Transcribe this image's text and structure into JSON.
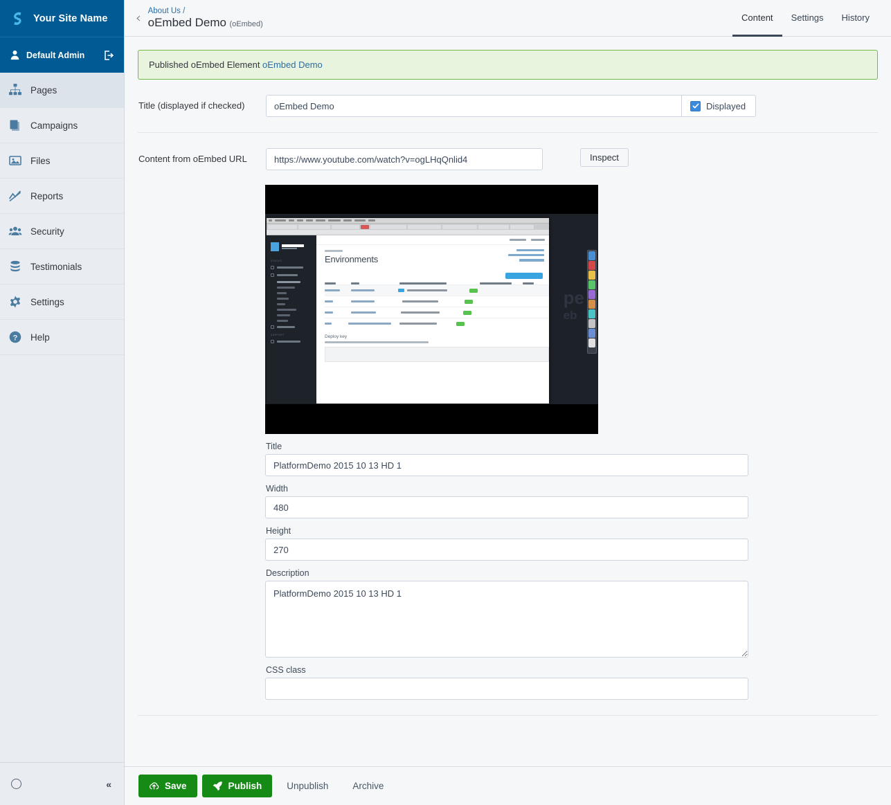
{
  "sidebar": {
    "brand": {
      "name": "Your Site Name",
      "logo_icon": "silverstripe-logo-icon"
    },
    "profile": {
      "name": "Default Admin",
      "user_icon": "user-icon",
      "logout_icon": "logout-icon"
    },
    "items": [
      {
        "label": "Pages",
        "icon": "sitemap-icon",
        "active": true
      },
      {
        "label": "Campaigns",
        "icon": "copies-icon",
        "active": false
      },
      {
        "label": "Files",
        "icon": "image-icon",
        "active": false
      },
      {
        "label": "Reports",
        "icon": "line-chart-icon",
        "active": false
      },
      {
        "label": "Security",
        "icon": "users-icon",
        "active": false
      },
      {
        "label": "Testimonials",
        "icon": "database-icon",
        "active": false
      },
      {
        "label": "Settings",
        "icon": "gear-icon",
        "active": false
      },
      {
        "label": "Help",
        "icon": "question-mark-icon",
        "active": false
      }
    ],
    "footer": {
      "spinner_icon": "loading-circle-icon",
      "collapse_icon": "chevron-double-left-icon",
      "collapse_label": "«"
    }
  },
  "header": {
    "back_icon": "chevron-left-icon",
    "back_label": "‹",
    "breadcrumb_parent": "About Us /",
    "title": "oEmbed Demo",
    "title_type": "(oEmbed)",
    "tabs": [
      {
        "label": "Content",
        "active": true
      },
      {
        "label": "Settings",
        "active": false
      },
      {
        "label": "History",
        "active": false
      }
    ]
  },
  "alert": {
    "text": "Published oEmbed Element ",
    "link_text": "oEmbed Demo",
    "bg_color": "#e8f4de",
    "border_color": "#73b947"
  },
  "form": {
    "title_field": {
      "label": "Title (displayed if checked)",
      "value": "oEmbed Demo",
      "placeholder": ""
    },
    "displayed_checkbox": {
      "label": "Displayed",
      "checked": true,
      "accent_color": "#3b8bdc"
    },
    "url_field": {
      "label": "Content from oEmbed URL",
      "value": "https://www.youtube.com/watch?v=ogLHqQnlid4",
      "placeholder": ""
    },
    "inspect_button": {
      "label": "Inspect"
    },
    "preview": {
      "alt": "PlatformDemo 2015 10 13 HD 1 video preview",
      "inner_heading": "Environments",
      "inner_section": "Deploy key",
      "inner_section_sub": "Permit us access to your private repositories by adding this deployment key",
      "brand": "SilverStripe"
    },
    "embed_fields": [
      {
        "name": "title",
        "label": "Title",
        "value": "PlatformDemo 2015 10 13 HD 1",
        "type": "text"
      },
      {
        "name": "width",
        "label": "Width",
        "value": "480",
        "type": "text"
      },
      {
        "name": "height",
        "label": "Height",
        "value": "270",
        "type": "text"
      },
      {
        "name": "description",
        "label": "Description",
        "value": "PlatformDemo 2015 10 13 HD 1",
        "type": "textarea"
      },
      {
        "name": "css-class",
        "label": "CSS class",
        "value": "",
        "type": "text"
      }
    ]
  },
  "actions": {
    "save": {
      "label": "Save",
      "icon": "cloud-upload-icon",
      "color": "#158a15"
    },
    "publish": {
      "label": "Publish",
      "icon": "rocket-icon",
      "color": "#158a15"
    },
    "unpublish": {
      "label": "Unpublish"
    },
    "archive": {
      "label": "Archive"
    }
  }
}
